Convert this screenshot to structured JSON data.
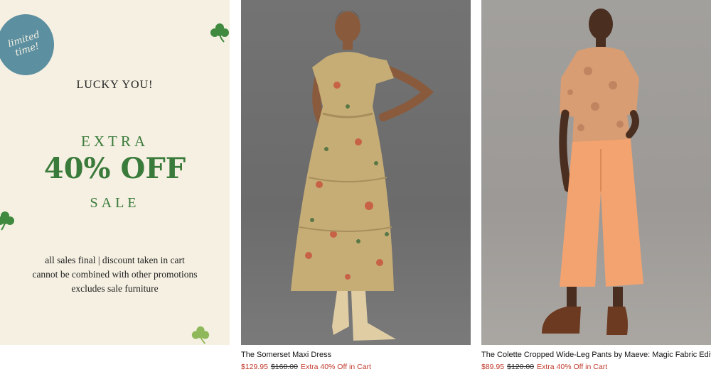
{
  "promo": {
    "badge": "limited\ntime!",
    "headline": "LUCKY YOU!",
    "extra": "EXTRA",
    "discount": "40% OFF",
    "sale": "SALE",
    "fine_print": [
      "all sales final | discount taken in cart",
      "cannot be combined with other promotions",
      "excludes sale furniture"
    ],
    "colors": {
      "background": "#f5f0e2",
      "green": "#3a7a3a",
      "badge": "#5c8fa0"
    },
    "icons": [
      "clover-icon"
    ]
  },
  "products": [
    {
      "name": "The Somerset Maxi Dress",
      "sale_price": "$129.95",
      "original_price": "$168.00",
      "promo": "Extra 40% Off in Cart"
    },
    {
      "name": "The Colette Cropped Wide-Leg Pants by Maeve: Magic Fabric Edition",
      "sale_price": "$89.95",
      "original_price": "$120.00",
      "promo": "Extra 40% Off in Cart"
    }
  ],
  "colors": {
    "sale_price": "#c0392b"
  }
}
